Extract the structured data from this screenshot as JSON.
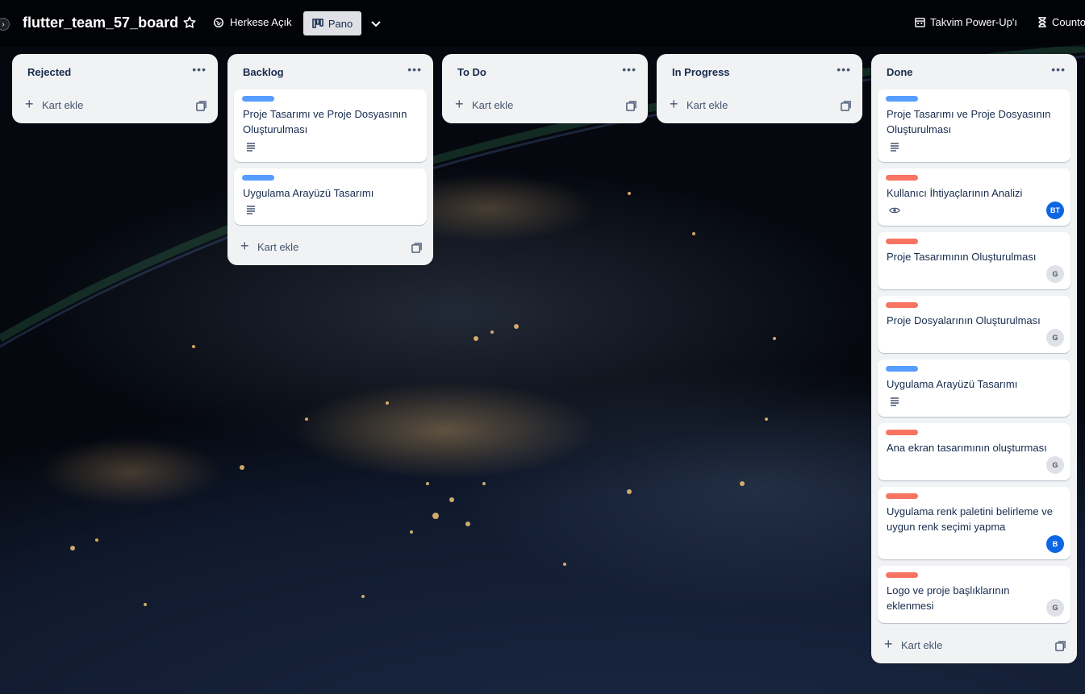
{
  "header": {
    "board_title": "flutter_team_57_board",
    "visibility_label": "Herkese Açık",
    "view_label": "Pano",
    "powerups": [
      "Takvim Power-Up'ı",
      "Counto"
    ]
  },
  "colors": {
    "label_blue": "#579dff",
    "label_red": "#f87462",
    "avatar_blue": "#0c66e4"
  },
  "add_card_label": "Kart ekle",
  "lists": [
    {
      "title": "Rejected",
      "cards": []
    },
    {
      "title": "Backlog",
      "cards": [
        {
          "title": "Proje Tasarımı ve Proje Dosyasının Oluşturulması",
          "label": "blue",
          "badge": "description-icon"
        },
        {
          "title": "Uygulama Arayüzü Tasarımı",
          "label": "blue",
          "badge": "description-icon"
        }
      ]
    },
    {
      "title": "To Do",
      "cards": []
    },
    {
      "title": "In Progress",
      "cards": []
    },
    {
      "title": "Done",
      "cards": [
        {
          "title": "Proje Tasarımı ve Proje Dosyasının Oluşturulması",
          "label": "blue",
          "badge": "description-icon"
        },
        {
          "title": "Kullanıcı İhtiyaçlarının Analizi",
          "label": "red",
          "badge": "eye-icon",
          "avatar": "BT"
        },
        {
          "title": "Proje Tasarımının Oluşturulması",
          "label": "red",
          "avatar": "G"
        },
        {
          "title": "Proje Dosyalarının Oluşturulması",
          "label": "red",
          "avatar": "G"
        },
        {
          "title": "Uygulama Arayüzü Tasarımı",
          "label": "blue",
          "badge": "description-icon"
        },
        {
          "title": "Ana ekran tasarımının oluşturması",
          "label": "red",
          "avatar": "G"
        },
        {
          "title": "Uygulama renk paletini belirleme ve uygun renk seçimi yapma",
          "label": "red",
          "avatar": "B"
        },
        {
          "title": "Logo ve proje başlıklarının eklenmesi",
          "label": "red",
          "avatar": "G"
        }
      ]
    }
  ]
}
